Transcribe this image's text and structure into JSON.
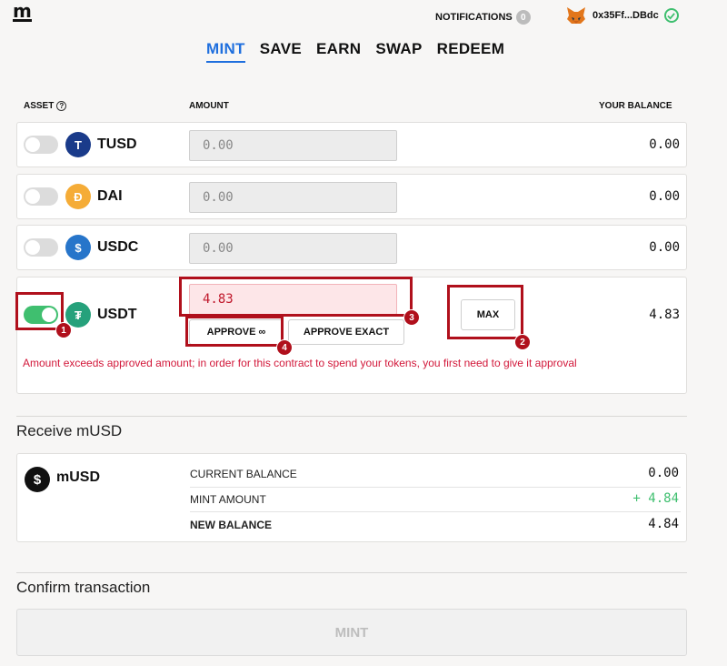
{
  "header": {
    "logo": "m",
    "notifications_label": "NOTIFICATIONS",
    "notifications_count": "0",
    "account": "0x35Ff...DBdc"
  },
  "tabs": [
    {
      "label": "MINT",
      "active": true
    },
    {
      "label": "SAVE"
    },
    {
      "label": "EARN"
    },
    {
      "label": "SWAP"
    },
    {
      "label": "REDEEM"
    }
  ],
  "columns": {
    "asset": "ASSET",
    "amount": "AMOUNT",
    "balance": "YOUR BALANCE"
  },
  "assets": [
    {
      "name": "TUSD",
      "amount_placeholder": "0.00",
      "balance": "0.00",
      "enabled": false,
      "color": "#1a3b8a"
    },
    {
      "name": "DAI",
      "amount_placeholder": "0.00",
      "balance": "0.00",
      "enabled": false,
      "color": "#f5ac37"
    },
    {
      "name": "USDC",
      "amount_placeholder": "0.00",
      "balance": "0.00",
      "enabled": false,
      "color": "#2775ca"
    },
    {
      "name": "USDT",
      "amount_value": "4.83",
      "balance": "4.83",
      "enabled": true,
      "color": "#26a17b"
    }
  ],
  "usdt_actions": {
    "max": "MAX",
    "approve_infinite": "APPROVE ∞",
    "approve_exact": "APPROVE EXACT",
    "error": "Amount exceeds approved amount; in order for this contract to spend your tokens, you first need to give it approval"
  },
  "annotations": [
    "1",
    "2",
    "3",
    "4"
  ],
  "receive": {
    "title": "Receive mUSD",
    "token": "mUSD",
    "current_balance_label": "CURRENT BALANCE",
    "current_balance": "0.00",
    "mint_amount_label": "MINT AMOUNT",
    "mint_amount": "+ 4.84",
    "new_balance_label": "NEW BALANCE",
    "new_balance": "4.84"
  },
  "confirm": {
    "title": "Confirm transaction",
    "button": "MINT"
  },
  "colors": {
    "accent": "#1f6fde",
    "success": "#3fbf6f",
    "error": "#d2183a",
    "highlight": "#b0101c"
  }
}
